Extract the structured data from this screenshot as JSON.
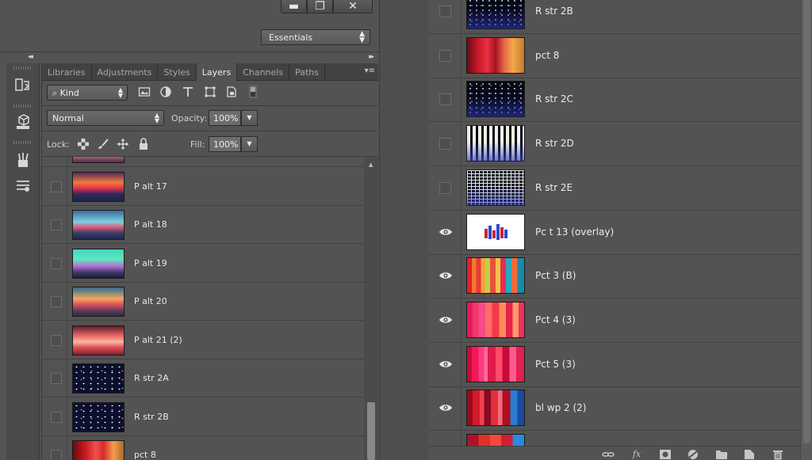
{
  "window": {
    "minimize": "▬",
    "restore": "❐",
    "close": "✕"
  },
  "workspace": {
    "label": "Essentials",
    "arrows": "⌃⌄"
  },
  "collapse_glyph": "◂◂",
  "expand_glyph": "▸▸",
  "tabs": [
    "Libraries",
    "Adjustments",
    "Styles",
    "Layers",
    "Channels",
    "Paths"
  ],
  "tab_menu": "▾≡",
  "filter": {
    "kind_label": "Kind",
    "icons": [
      "image-filter-icon",
      "adjustment-filter-icon",
      "type-filter-icon",
      "shape-filter-icon",
      "smart-object-filter-icon",
      "filter-toggle-icon"
    ]
  },
  "blend": {
    "mode": "Normal",
    "opacity_label": "Opacity:",
    "opacity": "100%",
    "fill_label": "Fill:",
    "fill": "100%"
  },
  "lock": {
    "label": "Lock:",
    "icons": [
      "lock-transparent-icon",
      "lock-image-icon",
      "lock-position-icon",
      "lock-all-icon"
    ]
  },
  "left_layers": [
    {
      "name": "",
      "visible": false,
      "thumb": "t-top"
    },
    {
      "name": "P alt 17",
      "visible": false,
      "thumb": "t-sunset1"
    },
    {
      "name": "P alt 18",
      "visible": false,
      "thumb": "t-sky18"
    },
    {
      "name": "P alt 19",
      "visible": false,
      "thumb": "t-sky19"
    },
    {
      "name": "P alt 20",
      "visible": false,
      "thumb": "t-sky20"
    },
    {
      "name": "P alt 21 (2)",
      "visible": false,
      "thumb": "t-sky21"
    },
    {
      "name": "R str 2A",
      "visible": false,
      "thumb": "t-stars"
    },
    {
      "name": "R str 2B",
      "visible": false,
      "thumb": "t-stars"
    },
    {
      "name": "pct 8",
      "visible": false,
      "thumb": "t-partialL"
    }
  ],
  "right_layers": [
    {
      "name": "R str 2B",
      "visible": false,
      "thumb": "t-stars-b"
    },
    {
      "name": "pct 8",
      "visible": false,
      "thumb": "t-pct8"
    },
    {
      "name": "R str 2C",
      "visible": false,
      "thumb": "t-stars-b"
    },
    {
      "name": "R str 2D",
      "visible": false,
      "thumb": "t-dash"
    },
    {
      "name": "R str 2E",
      "visible": false,
      "thumb": "t-grid"
    },
    {
      "name": "Pc t 13 (overlay)",
      "visible": true,
      "thumb": "t-overlay"
    },
    {
      "name": "Pct 3 (B)",
      "visible": true,
      "thumb": "t-pct3"
    },
    {
      "name": "Pct 4 (3)",
      "visible": true,
      "thumb": "t-pct4"
    },
    {
      "name": "Pct 5 (3)",
      "visible": true,
      "thumb": "t-pct5"
    },
    {
      "name": "bl wp 2 (2)",
      "visible": true,
      "thumb": "t-blwp"
    },
    {
      "name": "",
      "visible": true,
      "thumb": "t-partial"
    }
  ],
  "footer_icons": [
    "link-layers-icon",
    "fx-icon",
    "add-mask-icon",
    "adjustment-layer-icon",
    "new-group-icon",
    "new-layer-icon",
    "delete-layer-icon"
  ],
  "footer_fx": "fx"
}
